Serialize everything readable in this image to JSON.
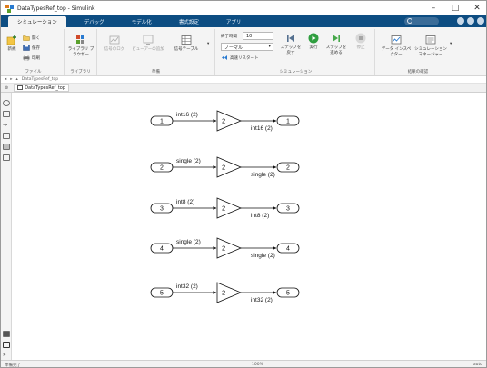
{
  "window": {
    "title": "DataTypesRef_top - Simulink",
    "controls": [
      "–",
      "□",
      "✕"
    ]
  },
  "tabs": [
    {
      "label": "シミュレーション",
      "active": true
    },
    {
      "label": "デバッグ",
      "active": false
    },
    {
      "label": "モデル化",
      "active": false
    },
    {
      "label": "書式設定",
      "active": false
    },
    {
      "label": "アプリ",
      "active": false
    }
  ],
  "ribbon": {
    "file": {
      "new_label": "新規",
      "open_label": "開く",
      "save_label": "保存",
      "print_label": "印刷",
      "group": "ファイル"
    },
    "library": {
      "browser_label": "ライブラリ ブラウザー",
      "group": "ライブラリ"
    },
    "prepare": {
      "signal_log_label": "信号のログ",
      "scope_label": "ビューアーの追加",
      "signal_table_label": "信号テーブル",
      "group": "準備"
    },
    "simulate": {
      "stop_time_label": "終了時間",
      "stop_time_value": "10",
      "mode_value": "ノーマル",
      "fast_restart_label": "高速リスタート",
      "step_back_label": "ステップを 戻す",
      "run_label": "実行",
      "step_forward_label": "ステップを 進める",
      "stop_label": "停止",
      "group": "シミュレーション"
    },
    "review": {
      "data_inspector_label": "データ インスペクター",
      "sim_manager_label": "シミュレーション マネージャー",
      "group": "結果の確認"
    }
  },
  "address": {
    "path": "DataTypesRef_top"
  },
  "model_tab": {
    "label": "DataTypesRef_top"
  },
  "status": {
    "left": "準備完了",
    "middle": "100%",
    "right": "auto"
  },
  "diagram": {
    "rows": [
      {
        "inport": "1",
        "in_type": "int16 (2)",
        "gain": "2",
        "out_type": "int16 (2)",
        "outport": "1"
      },
      {
        "inport": "2",
        "in_type": "single (2)",
        "gain": "2",
        "out_type": "single (2)",
        "outport": "2"
      },
      {
        "inport": "3",
        "in_type": "int8 (2)",
        "gain": "2",
        "out_type": "int8 (2)",
        "outport": "3"
      },
      {
        "inport": "4",
        "in_type": "single (2)",
        "gain": "2",
        "out_type": "single (2)",
        "outport": "4"
      },
      {
        "inport": "5",
        "in_type": "int32 (2)",
        "gain": "2",
        "out_type": "int32 (2)",
        "outport": "5"
      }
    ]
  },
  "colors": {
    "tab_strip": "#0d4d82",
    "ribbon_bg": "#f4f4f4",
    "run_green": "#2f9e3f",
    "step_green": "#46a84a"
  }
}
